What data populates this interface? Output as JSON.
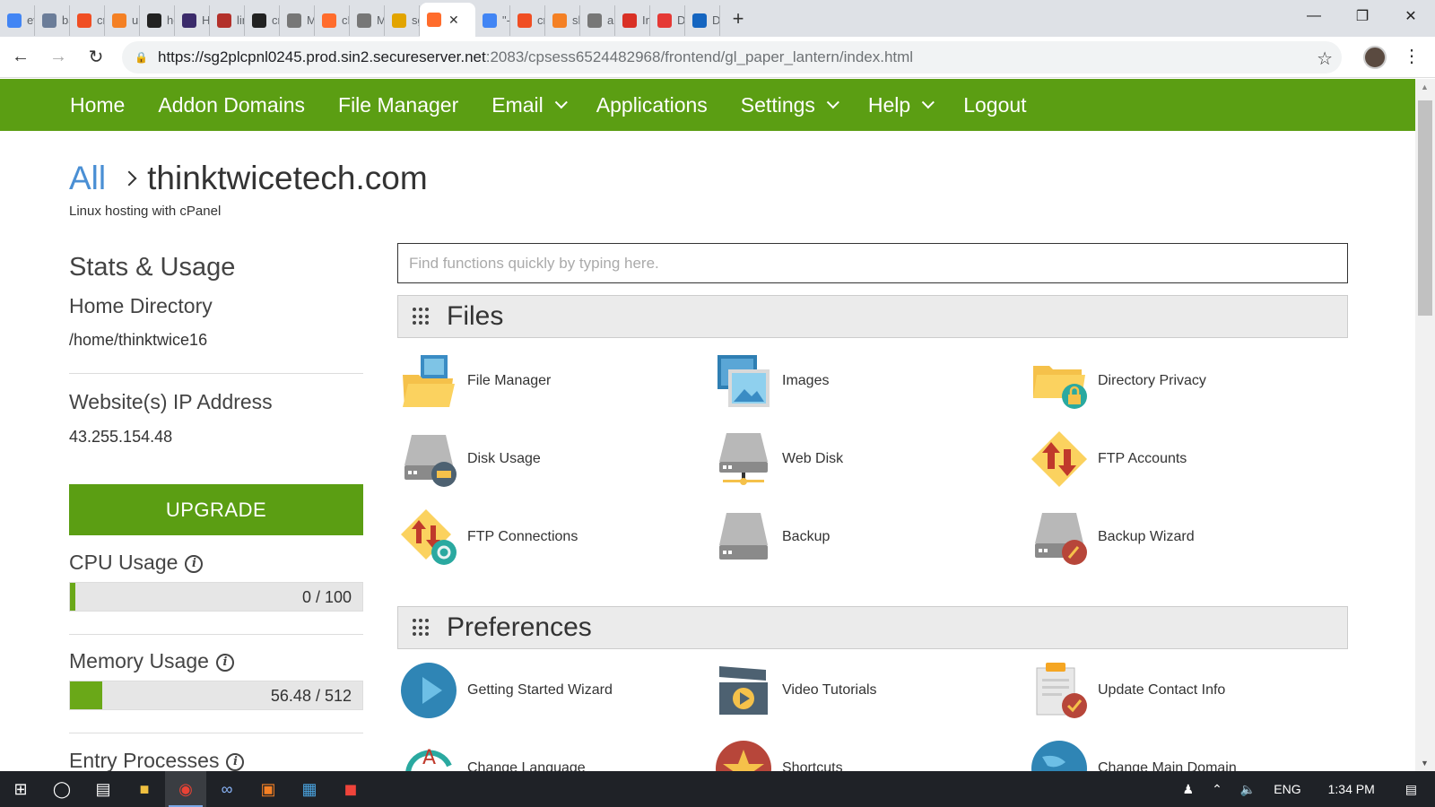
{
  "browser": {
    "tabs": [
      {
        "label": "ev",
        "icon": "google-icon",
        "color": "#4285f4"
      },
      {
        "label": "ba",
        "icon": "ul-icon",
        "color": "#6b7d99"
      },
      {
        "label": "cro",
        "icon": "ask-icon",
        "color": "#f04e23"
      },
      {
        "label": "ub",
        "icon": "stackoverflow-icon",
        "color": "#f48024"
      },
      {
        "label": "ho",
        "icon": "linux-icon",
        "color": "#222222"
      },
      {
        "label": "Ho",
        "icon": "ho-icon",
        "color": "#3b2b6b"
      },
      {
        "label": "lin",
        "icon": "bars-icon",
        "color": "#b3312b"
      },
      {
        "label": "cro",
        "icon": "c-icon",
        "color": "#222222"
      },
      {
        "label": "My",
        "icon": "hand-icon",
        "color": "#777777"
      },
      {
        "label": "cP",
        "icon": "cpanel-icon",
        "color": "#ff6c2c"
      },
      {
        "label": "My",
        "icon": "hand-icon",
        "color": "#777777"
      },
      {
        "label": "sg",
        "icon": "pma-icon",
        "color": "#e2a400"
      },
      {
        "label": "",
        "icon": "cpanel-icon",
        "color": "#ff6c2c",
        "active": true
      },
      {
        "label": "\"-\"",
        "icon": "google-icon",
        "color": "#4285f4"
      },
      {
        "label": "cro",
        "icon": "ask-icon",
        "color": "#f04e23"
      },
      {
        "label": "sh",
        "icon": "stackoverflow-icon",
        "color": "#f48024"
      },
      {
        "label": "ap",
        "icon": "doc-icon",
        "color": "#777777"
      },
      {
        "label": "Inl",
        "icon": "gmail-icon",
        "color": "#d93025"
      },
      {
        "label": "Do",
        "icon": "do-icon",
        "color": "#e53935"
      },
      {
        "label": "Do",
        "icon": "aus-icon",
        "color": "#1565c0"
      }
    ],
    "url_main": "https://sg2plcpnl0245.prod.sin2.secureserver.net",
    "url_rest": ":2083/cpsess6524482968/frontend/gl_paper_lantern/index.html"
  },
  "nav": {
    "items": [
      {
        "label": "Home",
        "dropdown": false
      },
      {
        "label": "Addon Domains",
        "dropdown": false
      },
      {
        "label": "File Manager",
        "dropdown": false
      },
      {
        "label": "Email",
        "dropdown": true
      },
      {
        "label": "Applications",
        "dropdown": false
      },
      {
        "label": "Settings",
        "dropdown": true
      },
      {
        "label": "Help",
        "dropdown": true
      },
      {
        "label": "Logout",
        "dropdown": false
      }
    ]
  },
  "header": {
    "crumb_all": "All",
    "domain": "thinktwicetech.com",
    "subtitle": "Linux hosting with cPanel"
  },
  "stats": {
    "title": "Stats & Usage",
    "home_dir_label": "Home Directory",
    "home_dir_value": "/home/thinktwice16",
    "ip_label": "Website(s) IP Address",
    "ip_value": "43.255.154.48",
    "upgrade_label": "UPGRADE",
    "cpu_label": "CPU Usage",
    "cpu_value": "0 / 100",
    "cpu_fraction": 0.018,
    "mem_label": "Memory Usage",
    "mem_value": "56.48 / 512",
    "mem_fraction": 0.11,
    "entry_label": "Entry Processes"
  },
  "search": {
    "placeholder": "Find functions quickly by typing here."
  },
  "files": {
    "title": "Files",
    "items": [
      {
        "label": "File Manager",
        "icon": "file-manager-icon"
      },
      {
        "label": "Images",
        "icon": "images-icon"
      },
      {
        "label": "Directory Privacy",
        "icon": "directory-privacy-icon"
      },
      {
        "label": "Disk Usage",
        "icon": "disk-usage-icon"
      },
      {
        "label": "Web Disk",
        "icon": "web-disk-icon"
      },
      {
        "label": "FTP Accounts",
        "icon": "ftp-accounts-icon"
      },
      {
        "label": "FTP Connections",
        "icon": "ftp-connections-icon"
      },
      {
        "label": "Backup",
        "icon": "backup-icon"
      },
      {
        "label": "Backup Wizard",
        "icon": "backup-wizard-icon"
      }
    ]
  },
  "preferences": {
    "title": "Preferences",
    "items": [
      {
        "label": "Getting Started Wizard",
        "icon": "getting-started-icon"
      },
      {
        "label": "Video Tutorials",
        "icon": "video-tutorials-icon"
      },
      {
        "label": "Update Contact Info",
        "icon": "contact-info-icon"
      },
      {
        "label": "Change Language",
        "icon": "change-language-icon"
      },
      {
        "label": "Shortcuts",
        "icon": "shortcuts-icon"
      },
      {
        "label": "Change Main Domain",
        "icon": "change-domain-icon"
      }
    ]
  },
  "taskbar": {
    "lang": "ENG",
    "time": "1:34 PM"
  },
  "colors": {
    "brand_green": "#5b9e13",
    "link_blue": "#4a8fd4"
  }
}
